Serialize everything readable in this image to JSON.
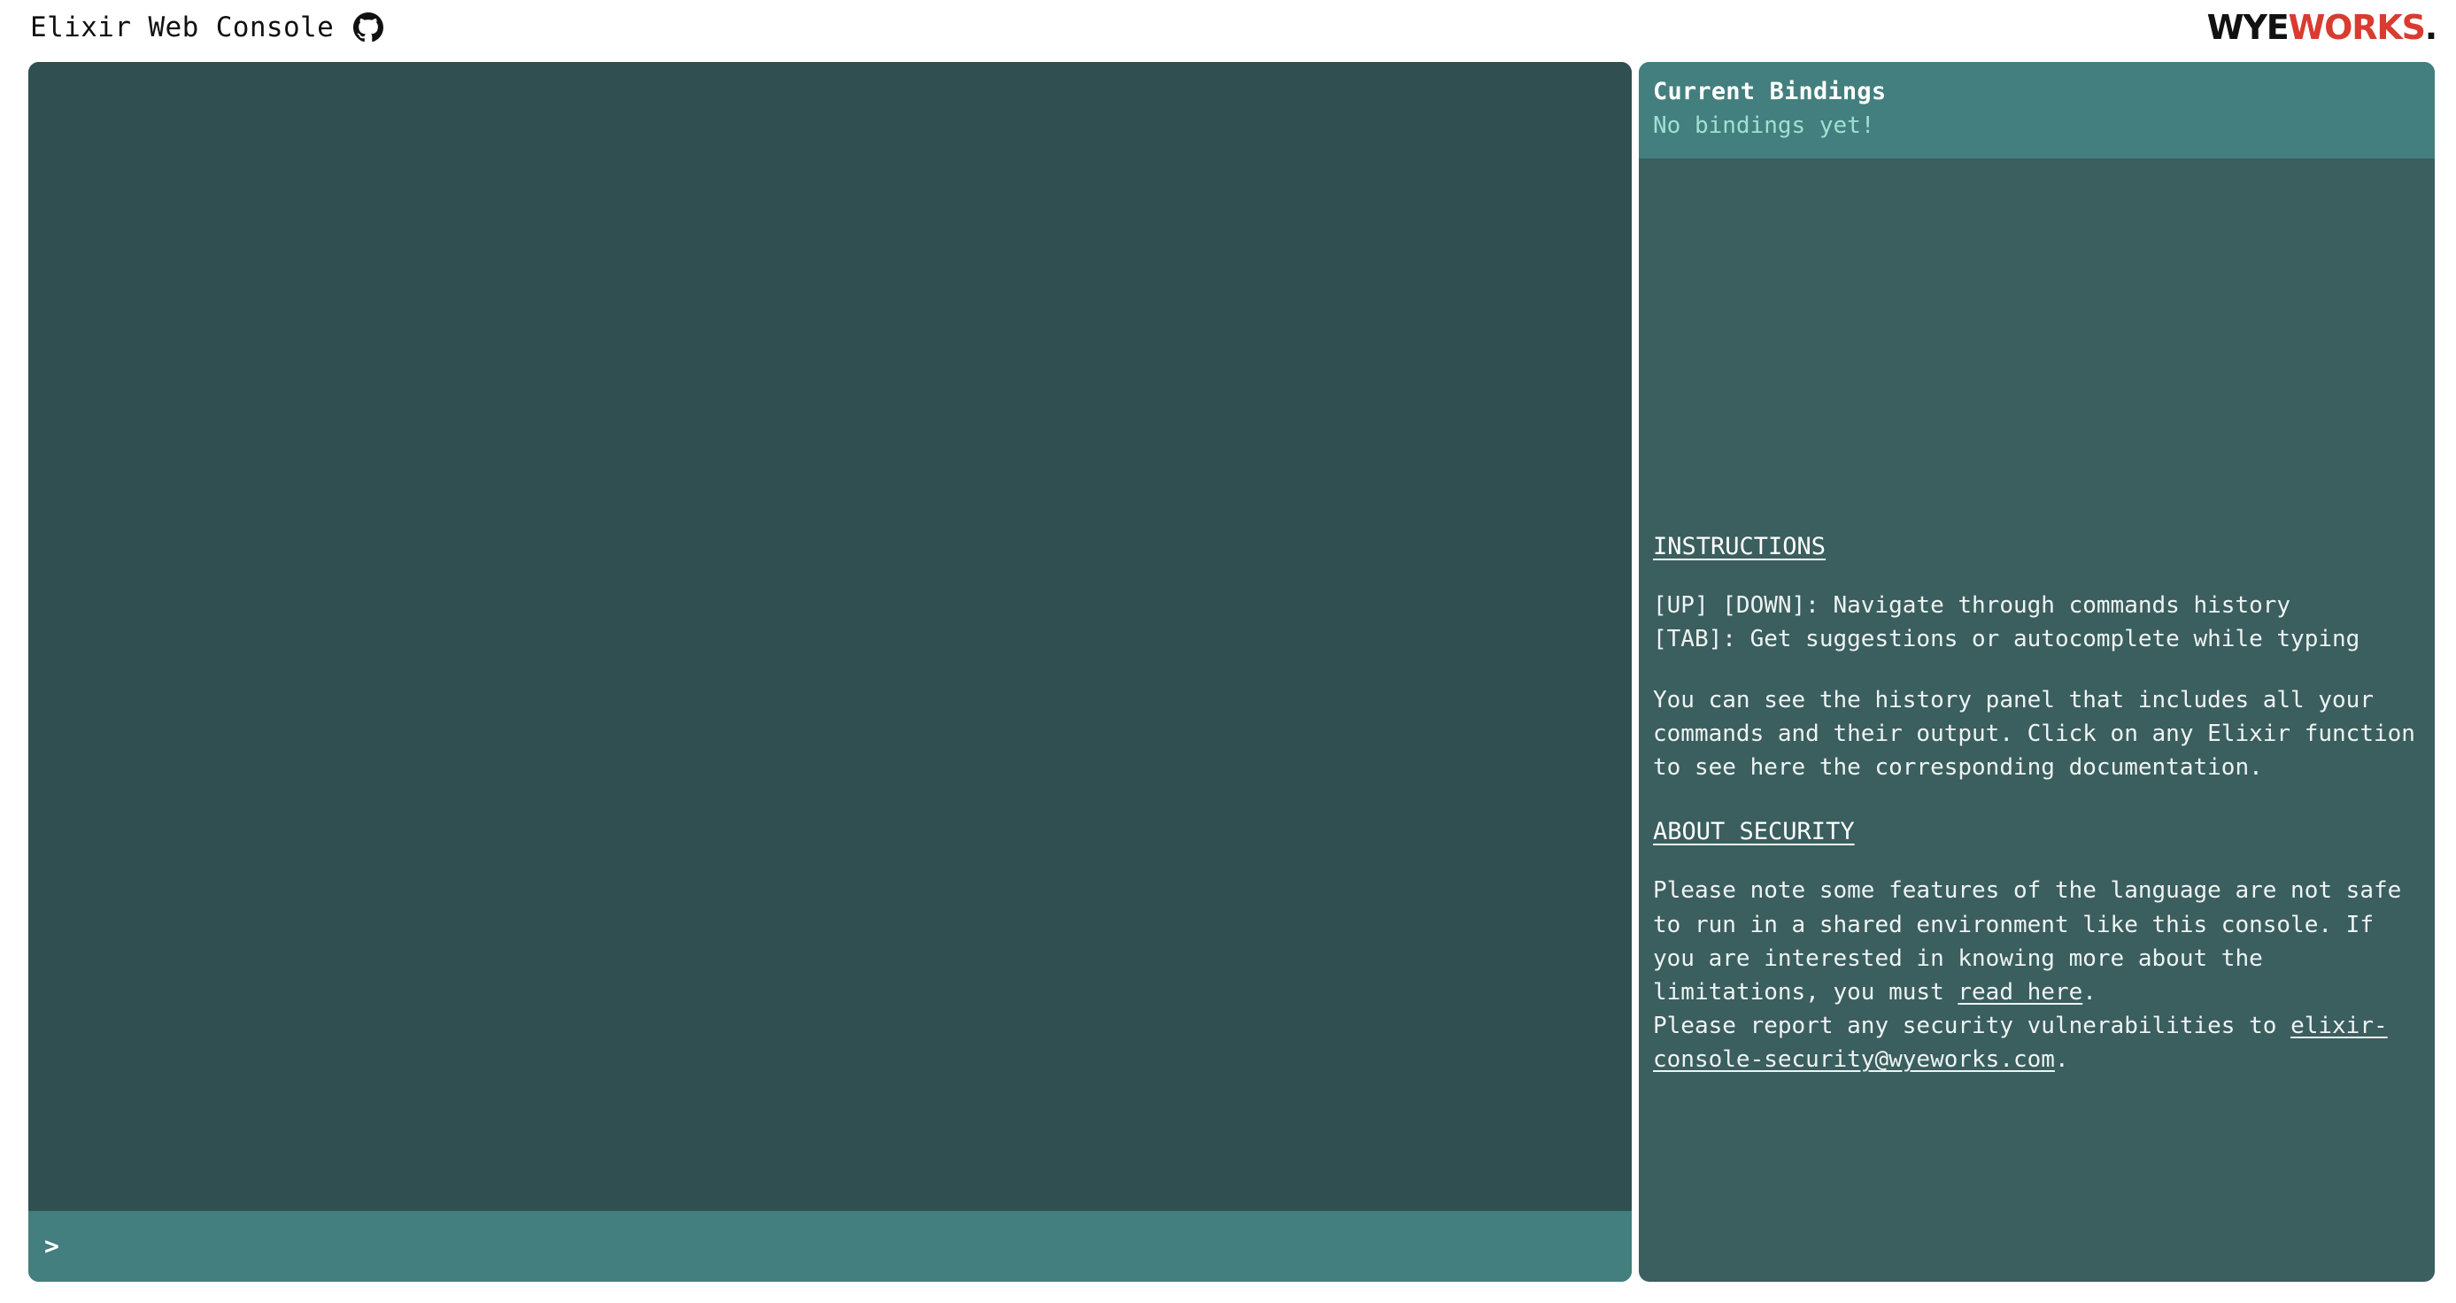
{
  "header": {
    "app_title": "Elixir Web Console",
    "github_icon": "github-icon",
    "logo": {
      "part1": "WYE",
      "part2": "WORKS",
      "part3": ".",
      "color_part1": "#111111",
      "color_part2": "#d93b30"
    }
  },
  "console": {
    "output_text": "",
    "prompt_symbol": ">",
    "input_value": "",
    "input_placeholder": ""
  },
  "sidebar": {
    "bindings": {
      "title": "Current Bindings",
      "empty_message": "No bindings yet!"
    },
    "instructions": {
      "heading": "INSTRUCTIONS",
      "shortcuts": "[UP] [DOWN]: Navigate through commands history\n[TAB]: Get suggestions or autocomplete while typing",
      "description": "You can see the history panel that includes all your commands and their output. Click on any Elixir function to see here the corresponding documentation."
    },
    "security": {
      "heading": "ABOUT SECURITY",
      "text_before_link": "Please note some features of the language are not safe to run in a shared environment like this console. If you are interested in knowing more about the limitations, you must ",
      "read_here_link": "read here",
      "text_after_link": ".",
      "report_text": "Please report any security vulnerabilities to ",
      "email_link": "elixir-console-security@wyeworks.com",
      "report_text_end": "."
    }
  },
  "colors": {
    "console_bg": "#2f4f50",
    "prompt_bar_bg": "#437f7e",
    "sidebar_bg": "#3b5e5f",
    "bindings_header_bg": "#437f7e",
    "accent_mint": "#9fe0d3",
    "brand_red": "#d93b30"
  }
}
